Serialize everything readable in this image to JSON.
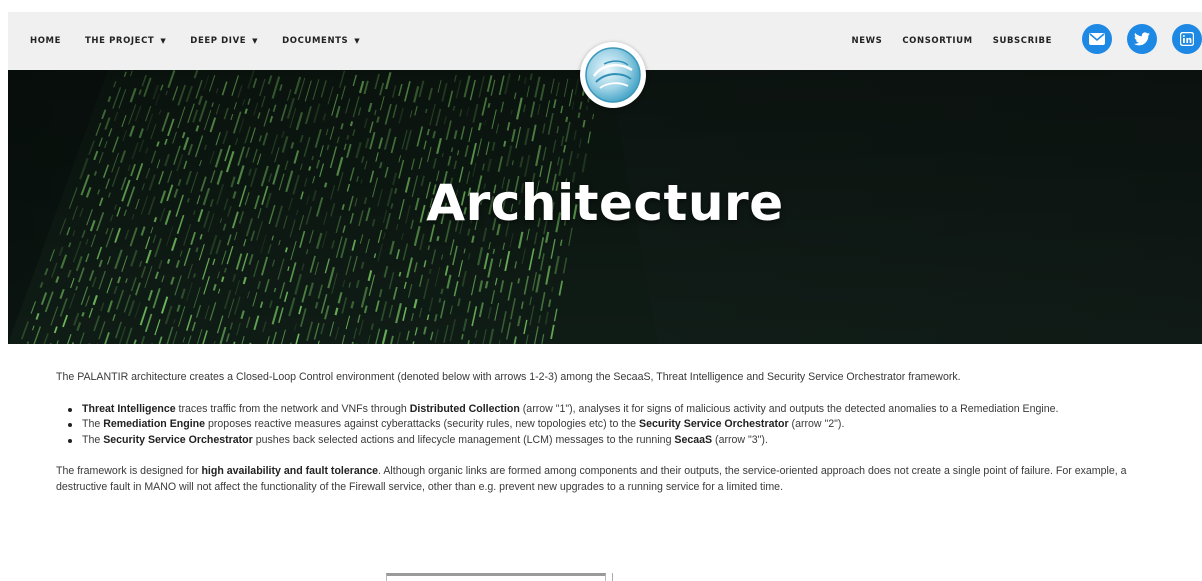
{
  "nav": {
    "left_items": [
      {
        "label": "HOME",
        "dropdown": false
      },
      {
        "label": "THE PROJECT",
        "dropdown": true
      },
      {
        "label": "DEEP DIVE",
        "dropdown": true
      },
      {
        "label": "DOCUMENTS",
        "dropdown": true
      }
    ],
    "right_items": [
      "NEWS",
      "CONSORTIUM",
      "SUBSCRIBE"
    ],
    "caret": "▼",
    "social": [
      {
        "icon": "email-icon",
        "color": "#1e88e5"
      },
      {
        "icon": "twitter-icon",
        "color": "#1e88e5"
      },
      {
        "icon": "linkedin-icon",
        "color": "#1e88e5"
      }
    ]
  },
  "hero": {
    "title": "Architecture",
    "logo_icon": "palantir-logo-icon"
  },
  "content": {
    "intro": "The PALANTIR architecture creates a Closed-Loop Control environment (denoted below with arrows 1-2-3) among the SecaaS, Threat Intelligence and Security Service Orchestrator framework.",
    "bullets": [
      {
        "b1": "Threat Intelligence",
        "t1": " traces traffic from the network and VNFs through ",
        "b2": "Distributed Collection",
        "t2": " (arrow \"1\"), analyses it for signs of malicious activity and outputs the detected anomalies to a Remediation Engine."
      },
      {
        "t0": "The ",
        "b1": "Remediation Engine",
        "t1": " proposes reactive measures against cyberattacks (security rules, new topologies etc) to the ",
        "b2": "Security Service Orchestrator",
        "t2": " (arrow \"2\")."
      },
      {
        "t0": "The ",
        "b1": "Security Service Orchestrator",
        "t1": " pushes back selected actions and lifecycle management (LCM) messages to the running ",
        "b2": "SecaaS",
        "t2": " (arrow \"3\")."
      }
    ],
    "closing_t0": "The framework is designed for ",
    "closing_b": "high availability and fault tolerance",
    "closing_t1": ". Although organic links are formed among components and their outputs, the service-oriented approach does not create a single point of failure. For example, a destructive fault in MANO will not affect the functionality of the Firewall service, other than e.g. prevent new upgrades to a running service for a limited time."
  },
  "colors": {
    "accent": "#1e88e5",
    "nav_bg": "#f0f0f0",
    "hero_bg": "#0b1310",
    "code_green": "#7fd36a"
  }
}
